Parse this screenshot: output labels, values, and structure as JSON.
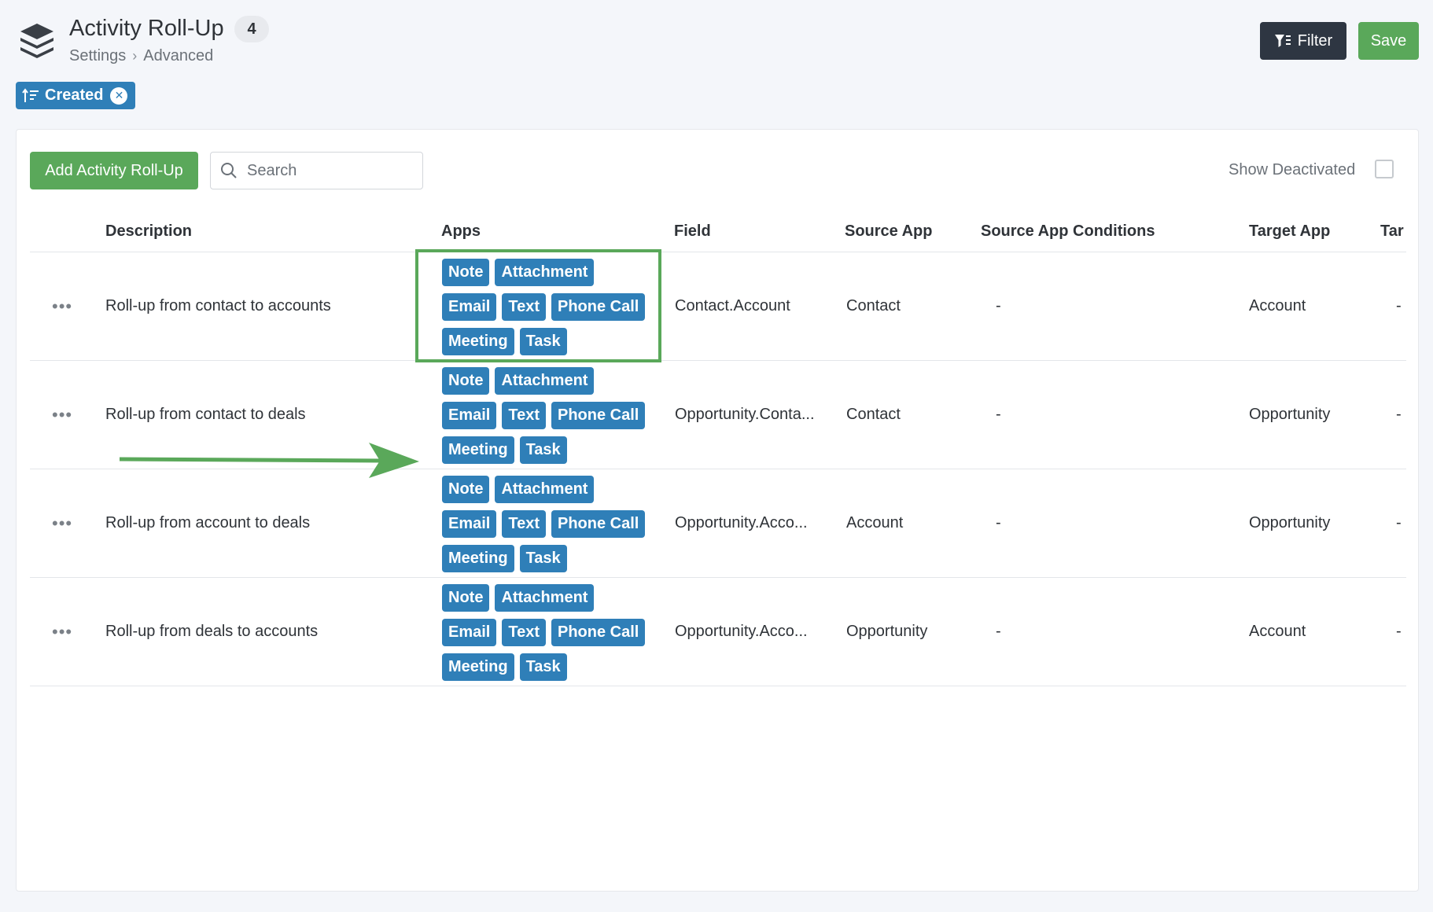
{
  "header": {
    "title": "Activity Roll-Up",
    "count": "4",
    "breadcrumb": [
      "Settings",
      "Advanced"
    ],
    "filter_label": "Filter",
    "save_label": "Save"
  },
  "sort_chip": {
    "label": "Created"
  },
  "toolbar": {
    "add_label": "Add Activity Roll-Up",
    "search_placeholder": "Search",
    "show_deactivated_label": "Show Deactivated"
  },
  "table": {
    "columns": [
      "Description",
      "Apps",
      "Field",
      "Source App",
      "Source App Conditions",
      "Target App",
      "Tar("
    ],
    "rows": [
      {
        "actions": "•••",
        "description": "Roll-up from contact to accounts",
        "apps": [
          [
            "Note",
            "Attachment"
          ],
          [
            "Email",
            "Text",
            "Phone Call"
          ],
          [
            "Meeting",
            "Task"
          ]
        ],
        "field": "Contact.Account",
        "source_app": "Contact",
        "source_conditions": "-",
        "target_app": "Account",
        "target_extra": "-"
      },
      {
        "actions": "•••",
        "description": "Roll-up from contact to deals",
        "apps": [
          [
            "Note",
            "Attachment"
          ],
          [
            "Email",
            "Text",
            "Phone Call"
          ],
          [
            "Meeting",
            "Task"
          ]
        ],
        "field": "Opportunity.Conta...",
        "source_app": "Contact",
        "source_conditions": "-",
        "target_app": "Opportunity",
        "target_extra": "-"
      },
      {
        "actions": "•••",
        "description": "Roll-up from account to deals",
        "apps": [
          [
            "Note",
            "Attachment"
          ],
          [
            "Email",
            "Text",
            "Phone Call"
          ],
          [
            "Meeting",
            "Task"
          ]
        ],
        "field": "Opportunity.Acco...",
        "source_app": "Account",
        "source_conditions": "-",
        "target_app": "Opportunity",
        "target_extra": "-"
      },
      {
        "actions": "•••",
        "description": "Roll-up from deals to accounts",
        "apps": [
          [
            "Note",
            "Attachment"
          ],
          [
            "Email",
            "Text",
            "Phone Call"
          ],
          [
            "Meeting",
            "Task"
          ]
        ],
        "field": "Opportunity.Acco...",
        "source_app": "Opportunity",
        "source_conditions": "-",
        "target_app": "Account",
        "target_extra": "-"
      }
    ]
  },
  "colors": {
    "tag_blue": "#2f7fb8",
    "green": "#5aa85a",
    "dark_button": "#2e3642"
  },
  "icons": [
    "stack-layers-icon",
    "chevron-right-icon",
    "filter-icon",
    "sort-icon",
    "close-icon",
    "search-icon",
    "ellipsis-icon",
    "arrow-right-icon"
  ]
}
